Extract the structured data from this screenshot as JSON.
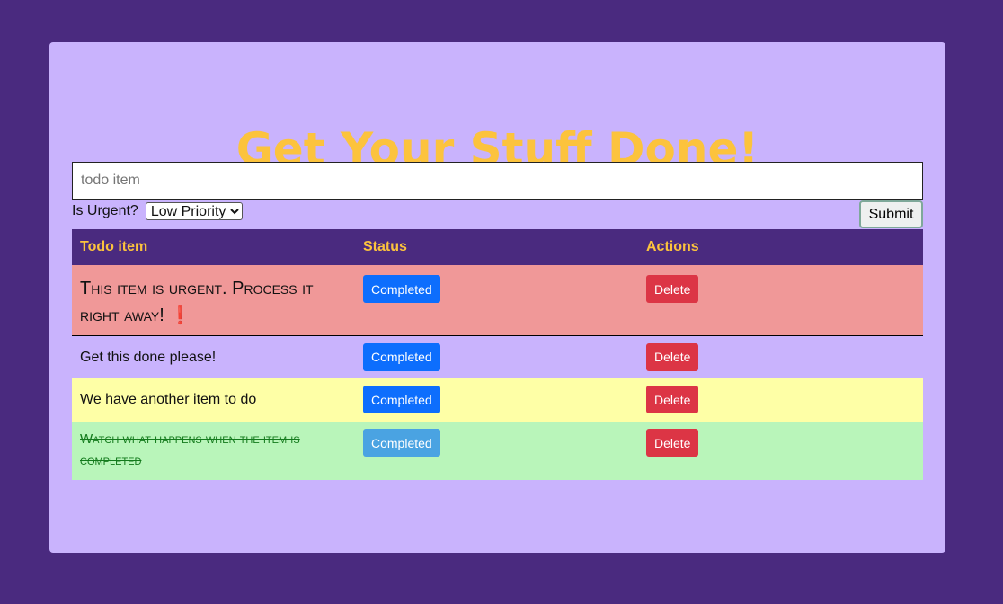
{
  "app": {
    "title": "Get Your Stuff Done!"
  },
  "form": {
    "input_placeholder": "todo item",
    "input_value": "",
    "urgent_label": "Is Urgent?",
    "priority_selected": "Low Priority",
    "submit_label": "Submit"
  },
  "table": {
    "headers": [
      "Todo item",
      "Status",
      "Actions"
    ],
    "rows": [
      {
        "text": "This item is urgent. Process it right away!",
        "mark": "❗",
        "status_label": "Completed",
        "action_label": "Delete",
        "style": "urgent"
      },
      {
        "text": "Get this done please!",
        "status_label": "Completed",
        "action_label": "Delete",
        "style": "normal"
      },
      {
        "text": "We have another item to do",
        "status_label": "Completed",
        "action_label": "Delete",
        "style": "yellow"
      },
      {
        "text": "Watch what happens when the item is completed",
        "status_label": "Completed",
        "action_label": "Delete",
        "style": "done"
      }
    ]
  },
  "colors": {
    "page_background": "#4a2a7f",
    "card_background": "#c9b3fd",
    "title_color": "#fcc33d",
    "urgent_row": "#f09898",
    "yellow_row": "#feffa6",
    "done_row": "#b9f5ba",
    "completed_button": "#0d6efd",
    "delete_button": "#dc3545"
  }
}
